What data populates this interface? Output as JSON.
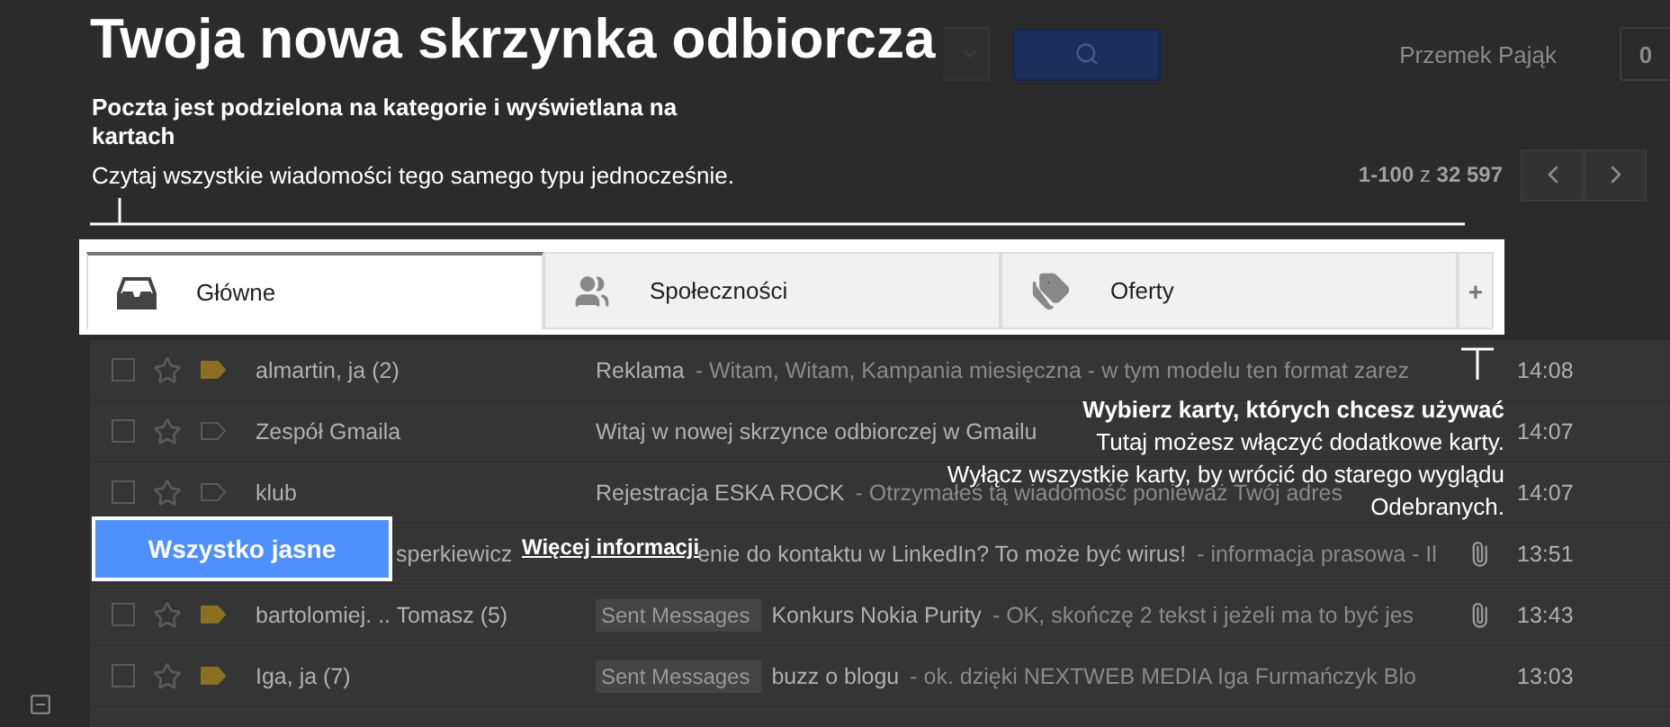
{
  "overlay": {
    "title": "Twoja nowa skrzynka odbiorcza",
    "heading": "Poczta jest podzielona na kategorie i wyświetlana na kartach",
    "description": "Czytaj wszystkie wiadomości tego samego typu jednocześnie.",
    "tip_heading": "Wybierz karty, których chcesz używać",
    "tip_lines": [
      "Tutaj możesz włączyć dodatkowe karty.",
      "Wyłącz wszystkie karty, by wrócić do starego wyglądu",
      "Odebranych."
    ],
    "confirm_button": "Wszystko jasne",
    "more_link": "Więcej informacji"
  },
  "header": {
    "user": "Przemek Pająk",
    "notifications": "0"
  },
  "toolbar": {
    "range": "**1-100** z **32 597**"
  },
  "tabs": [
    {
      "label": "Główne",
      "kind": "inbox",
      "selected": true
    },
    {
      "label": "Społeczności",
      "kind": "people",
      "selected": false
    },
    {
      "label": "Oferty",
      "kind": "tag",
      "selected": false
    }
  ],
  "add_tab": "+",
  "messages": [
    {
      "kind": "normal",
      "checked": false,
      "starred": false,
      "important": true,
      "sender": "almartin, ja (2)",
      "subject": "Reklama",
      "snippet": "- Witam, Witam, Kampania miesięczna - w tym modelu ten format zarez",
      "attachment": false,
      "time": "14:08"
    },
    {
      "kind": "normal",
      "checked": false,
      "starred": false,
      "important": false,
      "sender": "Zespół Gmaila",
      "subject": "Witaj w nowej skrzynce odbiorczej w Gmailu",
      "attachment": false,
      "time": "14:07"
    },
    {
      "kind": "normal",
      "checked": false,
      "starred": false,
      "important": false,
      "sender": "klub",
      "subject": "Rejestracja ESKA ROCK",
      "snippet": "- Otrzymałeś tą wiadomość ponieważ Twój adres",
      "attachment": false,
      "time": "14:07"
    },
    {
      "kind": "covered",
      "sender": "sperkiewicz",
      "subject": "enie do kontaktu w LinkedIn? To może być wirus!",
      "snippet": "- informacja prasowa - Il",
      "attachment": true,
      "time": "13:51"
    },
    {
      "kind": "normal",
      "checked": false,
      "starred": false,
      "important": true,
      "sender": "bartolomiej. .. Tomasz (5)",
      "tag": "Sent Messages",
      "subject": "Konkurs Nokia Purity",
      "snippet": "- OK, skończę 2 tekst i jeżeli ma to być jes",
      "attachment": true,
      "time": "13:43"
    },
    {
      "kind": "normal",
      "checked": false,
      "starred": false,
      "important": true,
      "sender": "Iga, ja (7)",
      "tag": "Sent Messages",
      "subject": "buzz o blogu",
      "snippet": "- ok. dzięki NEXTWEB MEDIA Iga Furmańczyk Blo",
      "attachment": false,
      "time": "13:03"
    }
  ]
}
